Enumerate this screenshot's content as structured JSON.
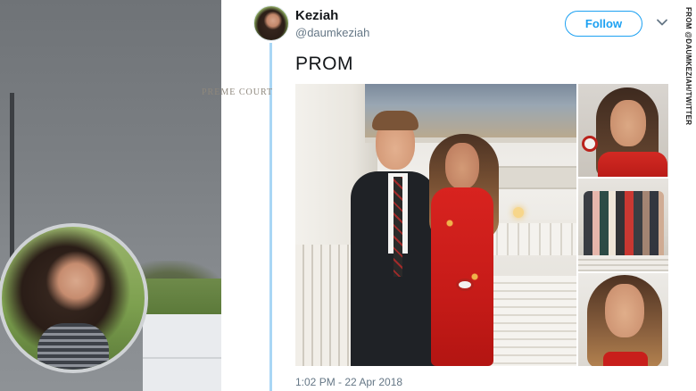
{
  "tweet": {
    "name": "Keziah",
    "handle": "@daumkeziah",
    "follow_label": "Follow",
    "text": "PROM",
    "timestamp": "1:02 PM - 22 Apr 2018"
  },
  "photo_frieze_text": "PREME COURT",
  "credit": "FROM @DAUMKEZIAH/TWITTER",
  "colors": {
    "accent": "#1da1f2",
    "thread_line": "#a9d6f5",
    "dress_red": "#c61b18"
  },
  "icons": {
    "chevron": "chevron-down-icon"
  }
}
